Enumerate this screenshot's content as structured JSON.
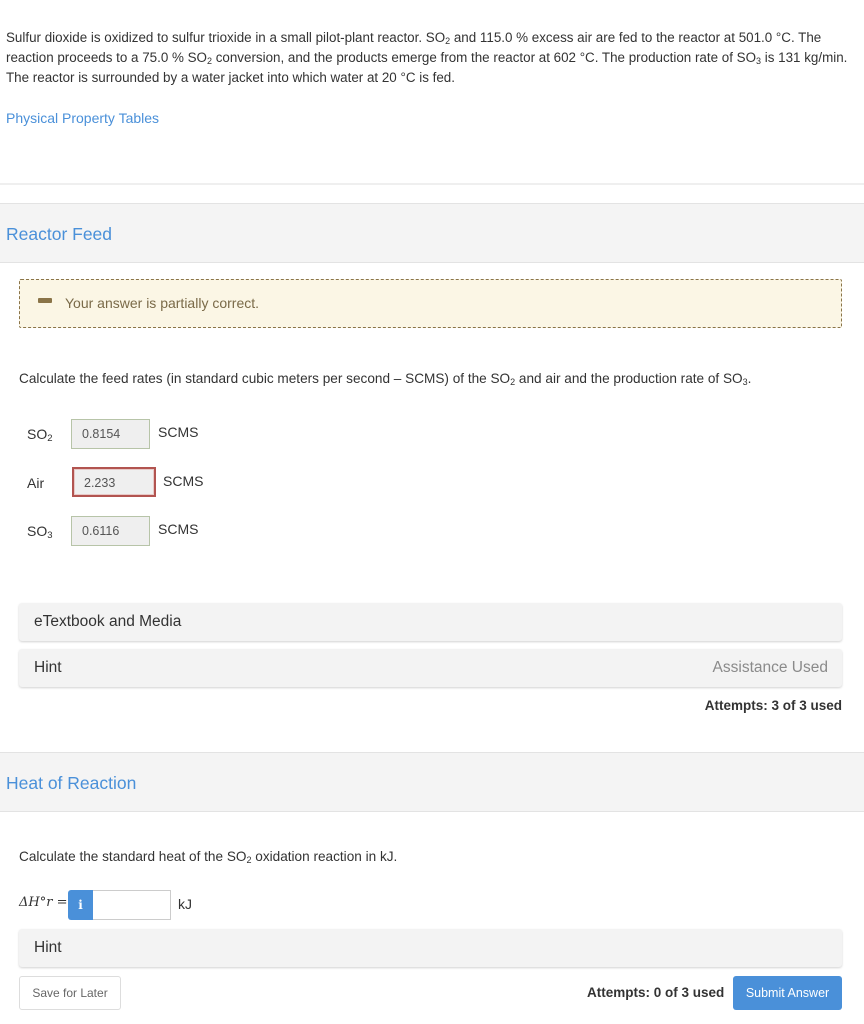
{
  "problem": {
    "part1": "Sulfur dioxide is oxidized to sulfur trioxide in a small pilot-plant reactor. SO",
    "sub1": "2",
    "part2": " and 115.0 % excess air are fed to the reactor at 501.0 °C. The reaction proceeds to a 75.0 % SO",
    "sub2": "2",
    "part3": " conversion, and the products emerge from the reactor at 602 °C. The production rate of SO",
    "sub3": "3",
    "part4": " is 131 kg/min. The reactor is surrounded by a water jacket into which water at 20 °C is fed."
  },
  "links": {
    "property_tables": "Physical Property Tables"
  },
  "sections": [
    {
      "title": "Reactor Feed",
      "feedback": {
        "icon": "partial-dash-icon",
        "message": "Your answer is partially correct."
      },
      "question": {
        "part1": "Calculate the feed rates (in standard cubic meters per second – SCMS) of the SO",
        "sub1": "2",
        "part2": " and air and the production rate of SO",
        "sub2": "3",
        "part3": "."
      },
      "rows": [
        {
          "label": "SO",
          "sub": "2",
          "value": "0.8154",
          "unit": "SCMS",
          "status": "correct"
        },
        {
          "label": "Air",
          "sub": "",
          "value": "2.233",
          "unit": "SCMS",
          "status": "incorrect"
        },
        {
          "label": "SO",
          "sub": "3",
          "value": "0.6116",
          "unit": "SCMS",
          "status": "correct"
        }
      ],
      "etextbook_label": "eTextbook and Media",
      "hint_label": "Hint",
      "assistance": "Assistance Used",
      "attempts": "Attempts: 3 of 3 used"
    },
    {
      "title": "Heat of Reaction",
      "question": {
        "part1": "Calculate the standard heat of the SO",
        "sub1": "2",
        "part2": " oxidation reaction in kJ."
      },
      "input_label": "ΔH°r =",
      "info_icon": "i",
      "input_value": "",
      "unit": "kJ",
      "hint_label": "Hint",
      "attempts": "Attempts: 0 of 3 used"
    }
  ],
  "buttons": {
    "save": "Save for Later",
    "submit": "Submit Answer"
  },
  "colors": {
    "accent": "#4a90d9",
    "partial": "#8a7448",
    "incorrect": "#b25450",
    "correct_border": "#b7c4a8"
  }
}
